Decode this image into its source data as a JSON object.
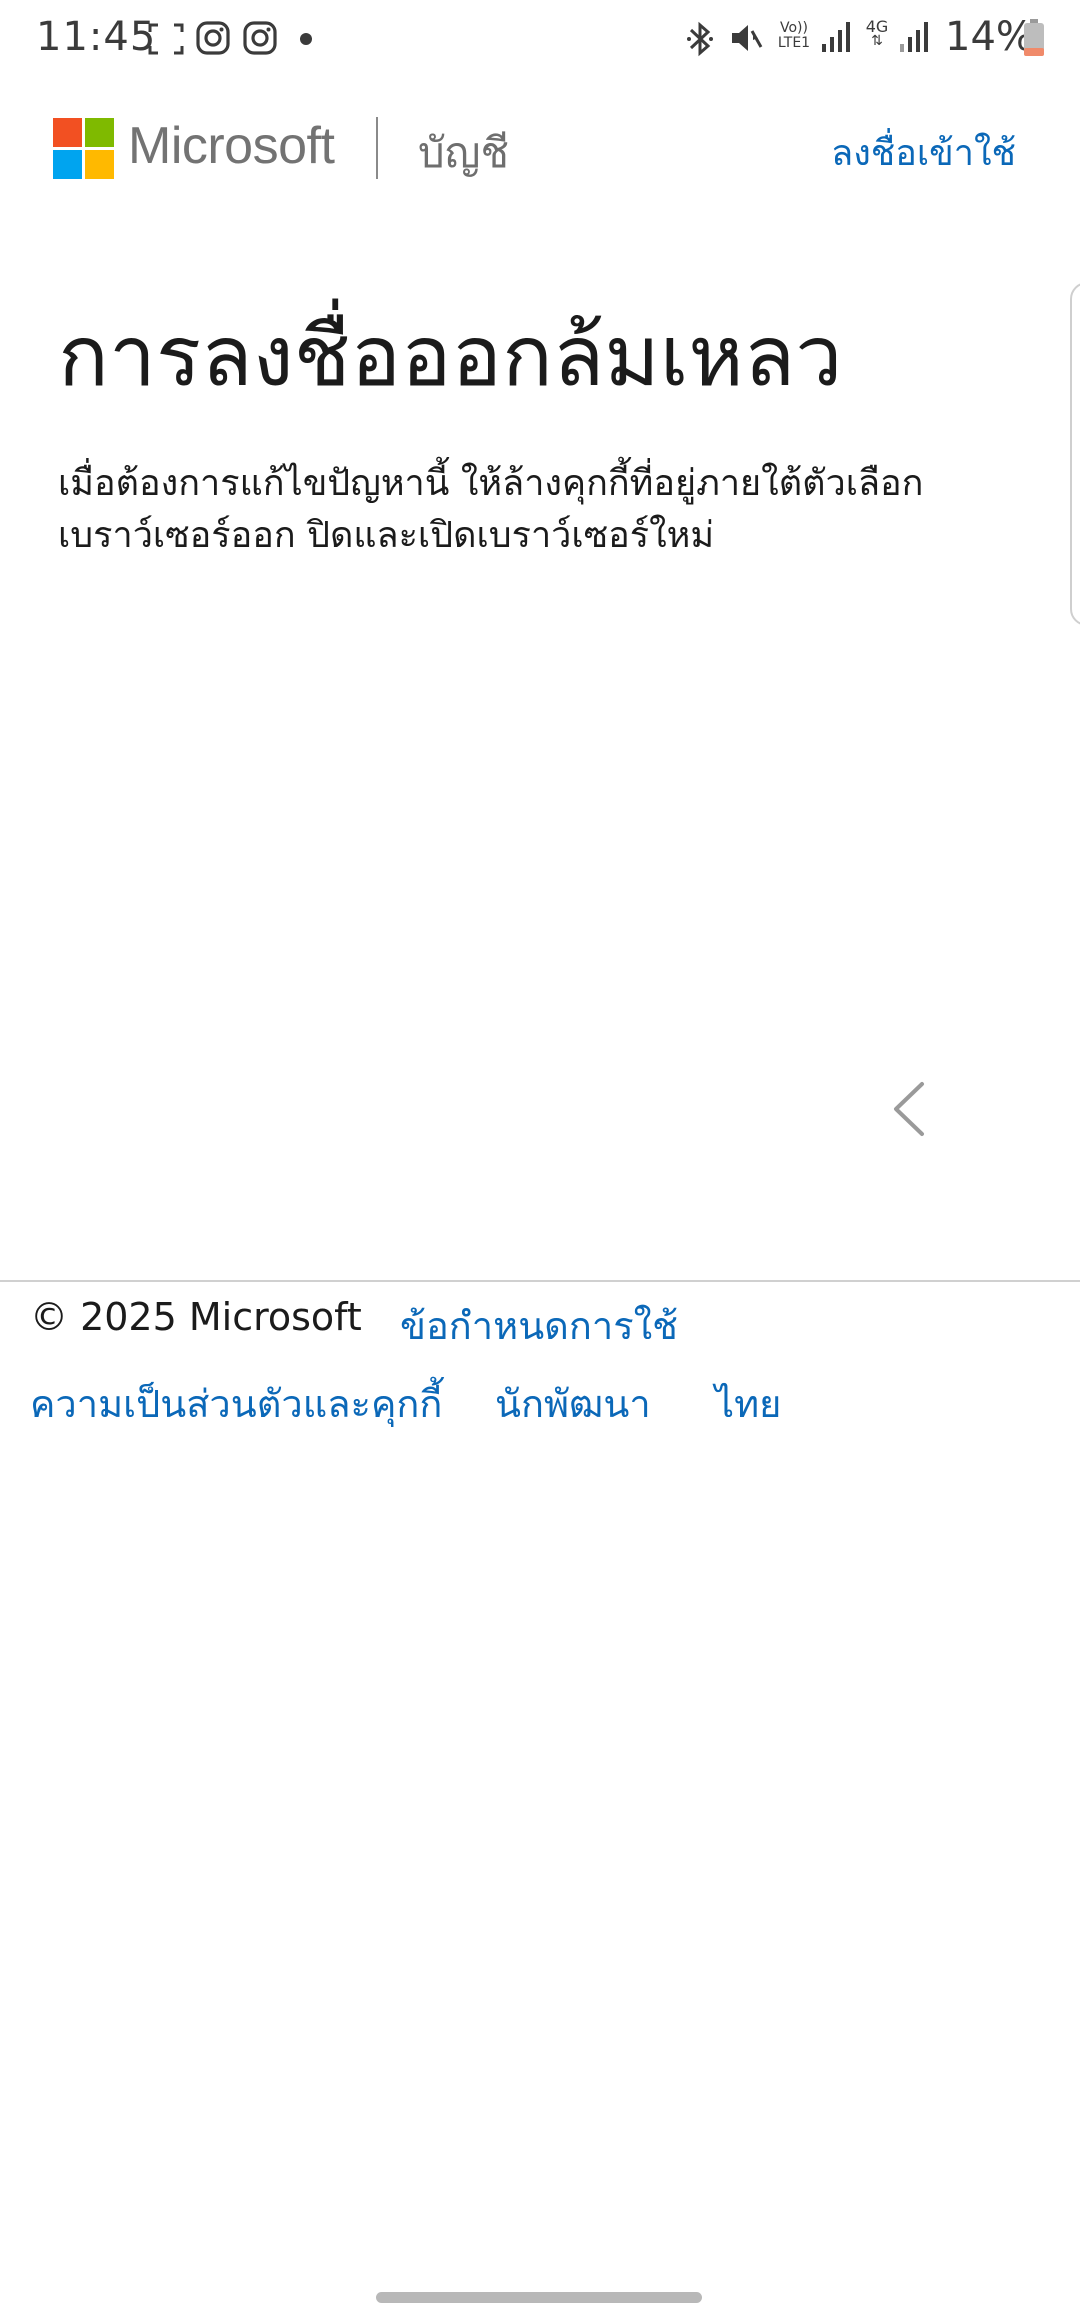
{
  "status_bar": {
    "time": "11:45",
    "battery_text": "14%",
    "volte_label_1": "Vo))",
    "volte_label_2": "LTE1",
    "network_label_1": "4G",
    "icons": [
      "screenshot-frame-icon",
      "instagram-icon",
      "instagram-icon",
      "notification-dot",
      "bluetooth-icon",
      "mute-icon",
      "volte-icon",
      "signal-icon",
      "4g-data-icon",
      "signal-icon",
      "battery-icon"
    ]
  },
  "header": {
    "brand": "Microsoft",
    "section": "บัญชี",
    "signin_label": "ลงชื่อเข้าใช้"
  },
  "main": {
    "title": "การลงชื่อออกล้มเหลว",
    "description": "เมื่อต้องการแก้ไขปัญหานี้ ให้ล้างคุกกี้ที่อยู่ภายใต้ตัวเลือกเบราว์เซอร์ออก ปิดและเปิดเบราว์เซอร์ใหม่"
  },
  "footer": {
    "copyright": "© 2025 Microsoft",
    "terms": "ข้อกำหนดการใช้",
    "privacy": "ความเป็นส่วนตัวและคุกกี้",
    "developers": "นักพัฒนา",
    "language": "ไทย"
  },
  "colors": {
    "link": "#0b68b8",
    "logo_red": "#f25022",
    "logo_green": "#7fba00",
    "logo_blue": "#00a4ef",
    "logo_yellow": "#ffb900",
    "wordmark_gray": "#737373"
  }
}
